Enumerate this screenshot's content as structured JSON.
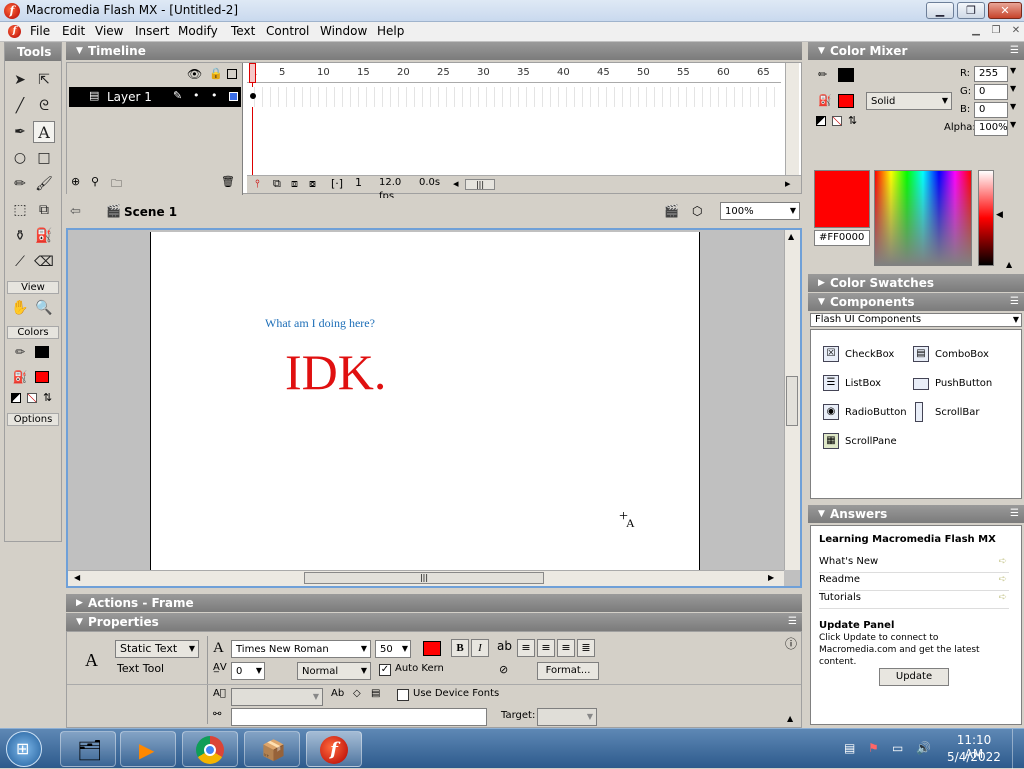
{
  "window": {
    "title": "Macromedia Flash MX - [Untitled-2]"
  },
  "menu": [
    "File",
    "Edit",
    "View",
    "Insert",
    "Modify",
    "Text",
    "Control",
    "Window",
    "Help"
  ],
  "tools": {
    "header": "Tools",
    "view_label": "View",
    "colors_label": "Colors",
    "options_label": "Options",
    "stroke_color": "#000000",
    "fill_color": "#FF0000"
  },
  "timeline": {
    "header": "Timeline",
    "layer_name": "Layer 1",
    "frame_numbers": [
      "1",
      "5",
      "10",
      "15",
      "20",
      "25",
      "30",
      "35",
      "40",
      "45",
      "50",
      "55",
      "60",
      "65"
    ],
    "current_frame": "1",
    "fps": "12.0 fps",
    "elapsed": "0.0s"
  },
  "stagebar": {
    "scene": "Scene 1",
    "zoom": "100%"
  },
  "stage": {
    "question_text": "What am I doing here?",
    "answer_text": "IDK.",
    "question_color": "#1e6fb8",
    "answer_color": "#e01010"
  },
  "actions": {
    "header": "Actions - Frame"
  },
  "properties": {
    "header": "Properties",
    "text_type": "Static Text",
    "tool_label": "Text Tool",
    "font": "Times New Roman",
    "size": "50",
    "tracking": "0",
    "baseline": "Normal",
    "auto_kern": "Auto Kern",
    "format_button": "Format...",
    "device_fonts": "Use Device Fonts",
    "target_label": "Target:",
    "text_color": "#FF0000"
  },
  "color_mixer": {
    "header": "Color Mixer",
    "fill_style": "Solid",
    "r_label": "R:",
    "r": "255",
    "g_label": "G:",
    "g": "0",
    "b_label": "B:",
    "b": "0",
    "alpha_label": "Alpha:",
    "alpha": "100%",
    "hex": "#FF0000"
  },
  "swatches": {
    "header": "Color Swatches"
  },
  "components": {
    "header": "Components",
    "set": "Flash UI Components",
    "items": [
      "CheckBox",
      "ComboBox",
      "ListBox",
      "PushButton",
      "RadioButton",
      "ScrollBar",
      "ScrollPane"
    ]
  },
  "answers": {
    "header": "Answers",
    "learning_title": "Learning Macromedia Flash MX",
    "links": [
      "What's New",
      "Readme",
      "Tutorials"
    ],
    "update_title": "Update Panel",
    "update_desc": "Click Update to connect to Macromedia.com and get the latest content.",
    "update_button": "Update"
  },
  "taskbar": {
    "time": "11:10 AM",
    "date": "5/4/2022"
  }
}
